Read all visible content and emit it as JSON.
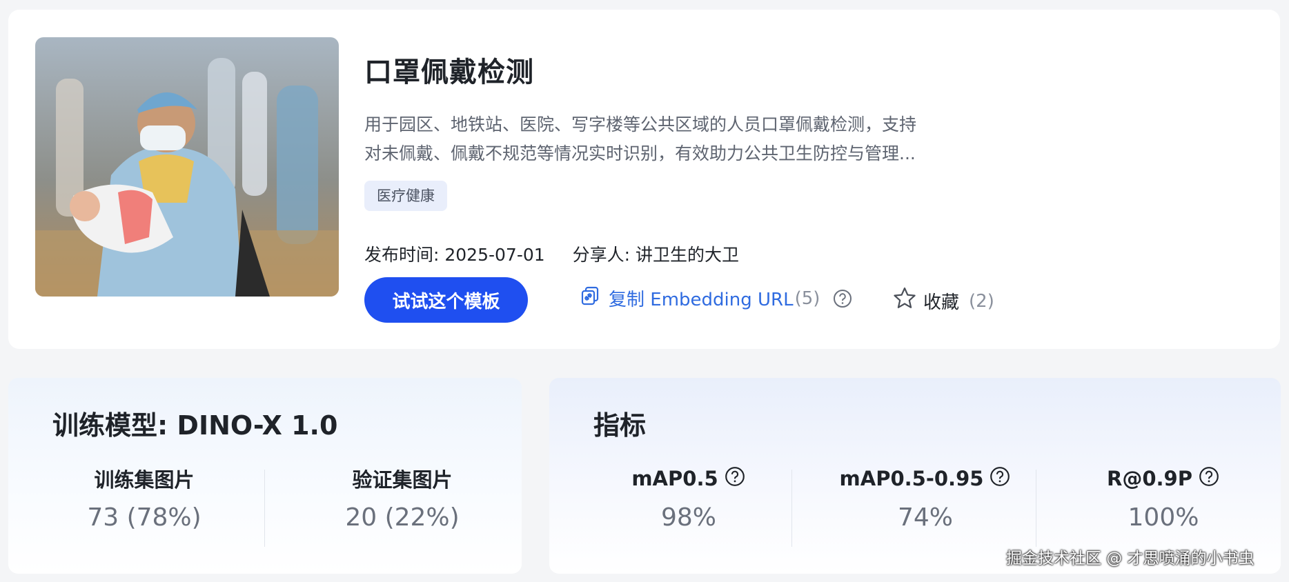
{
  "template": {
    "title": "口罩佩戴检测",
    "description_line1": "用于园区、地铁站、医院、写字楼等公共区域的人员口罩佩戴检测，支持",
    "description_line2": "对未佩戴、佩戴不规范等情况实时识别，有效助力公共卫生防控与管理...",
    "tag": "医疗健康",
    "publish_label": "发布时间: 2025-07-01",
    "sharer_label": "分享人: 讲卫生的大卫",
    "try_button": "试试这个模板",
    "copy_label": "复制 Embedding URL",
    "copy_count": "(5)",
    "favorite_label": "收藏",
    "favorite_count": "(2)"
  },
  "training": {
    "title": "训练模型: DINO-X 1.0",
    "train_images_label": "训练集图片",
    "train_images_value": "73 (78%)",
    "val_images_label": "验证集图片",
    "val_images_value": "20 (22%)"
  },
  "metrics": {
    "title": "指标",
    "items": [
      {
        "label": "mAP0.5",
        "value": "98%"
      },
      {
        "label": "mAP0.5-0.95",
        "value": "74%"
      },
      {
        "label": "R@0.9P",
        "value": "100%"
      }
    ]
  },
  "watermark": "掘金技术社区 @ 才思喷涌的小书虫",
  "colors": {
    "accent": "#1f4ff0",
    "link": "#2f6be0",
    "tag_bg": "#e9eefb"
  },
  "icons": [
    "copy-link-icon",
    "help-icon",
    "star-icon"
  ]
}
